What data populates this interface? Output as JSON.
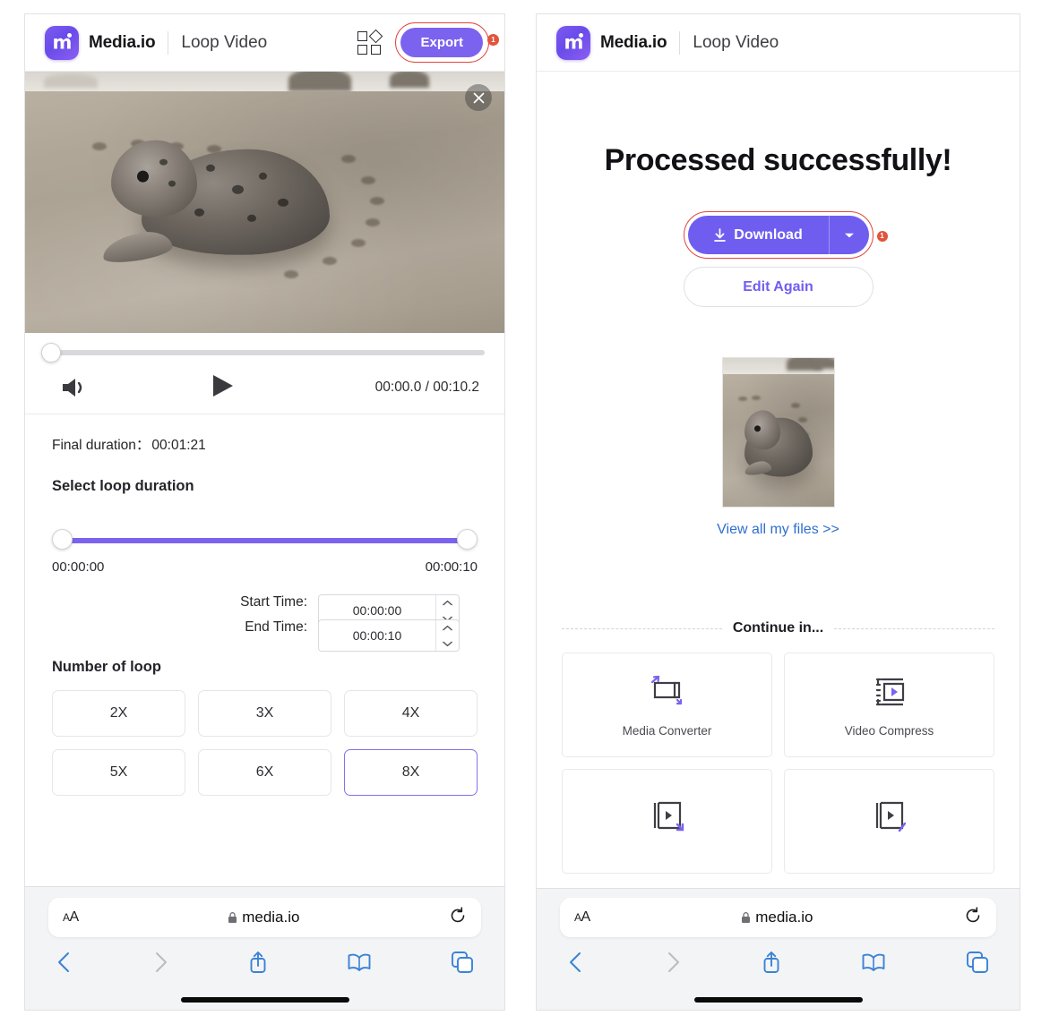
{
  "brand": {
    "name": "Media.io",
    "logo_letter": "m",
    "accent": "#7b63ef"
  },
  "left_phone": {
    "header": {
      "tool_title": "Loop Video",
      "grid_icon": "grid-apps-icon",
      "export_label": "Export",
      "export_badge": "1",
      "highlight_color": "#e4433c"
    },
    "preview": {
      "close_icon": "close-icon",
      "alt": "seal on beach sand"
    },
    "player": {
      "volume_icon": "volume-icon",
      "play_icon": "play-icon",
      "time_display": "00:00.0 / 00:10.2",
      "seek_position_pct": 0
    },
    "settings": {
      "final_duration_label": "Final duration：",
      "final_duration_value": "00:01:21",
      "loop_duration_heading": "Select loop duration",
      "range_start_label": "00:00:00",
      "range_end_label": "00:00:10",
      "start_time_label": "Start Time:",
      "start_time_value": "00:00:00",
      "end_time_label": "End Time:",
      "end_time_value": "00:00:10",
      "number_of_loop_heading": "Number of loop",
      "loop_options": [
        {
          "label": "2X",
          "selected": false
        },
        {
          "label": "3X",
          "selected": false
        },
        {
          "label": "4X",
          "selected": false
        },
        {
          "label": "5X",
          "selected": false
        },
        {
          "label": "6X",
          "selected": false
        },
        {
          "label": "8X",
          "selected": true
        }
      ],
      "selected_border_color": "#8372ea"
    },
    "safari": {
      "text_size_label": "AA",
      "lock_icon": "lock-icon",
      "url": "media.io",
      "reload_icon": "reload-icon",
      "back_icon": "chevron-left-icon",
      "forward_icon": "chevron-right-icon",
      "share_icon": "share-icon",
      "bookmarks_icon": "book-icon",
      "tabs_icon": "tabs-icon"
    }
  },
  "right_phone": {
    "header": {
      "tool_title": "Loop Video"
    },
    "success": {
      "title": "Processed successfully!",
      "download_label": "Download",
      "download_icon": "download-icon",
      "download_caret_icon": "chevron-down-icon",
      "download_badge": "1",
      "edit_again_label": "Edit Again",
      "thumbnail_alt": "seal on beach sand",
      "files_link_label": "View all my files >>"
    },
    "continue": {
      "heading": "Continue in...",
      "cards": [
        {
          "name": "Media Converter",
          "icon": "media-converter-icon"
        },
        {
          "name": "Video Compress",
          "icon": "video-compress-icon"
        },
        {
          "name": "",
          "icon": "video-trim-icon"
        },
        {
          "name": "",
          "icon": "video-cut-icon"
        }
      ]
    },
    "safari": {
      "text_size_label": "AA",
      "lock_icon": "lock-icon",
      "url": "media.io",
      "reload_icon": "reload-icon",
      "back_icon": "chevron-left-icon",
      "forward_icon": "chevron-right-icon",
      "share_icon": "share-icon",
      "bookmarks_icon": "book-icon",
      "tabs_icon": "tabs-icon"
    }
  }
}
